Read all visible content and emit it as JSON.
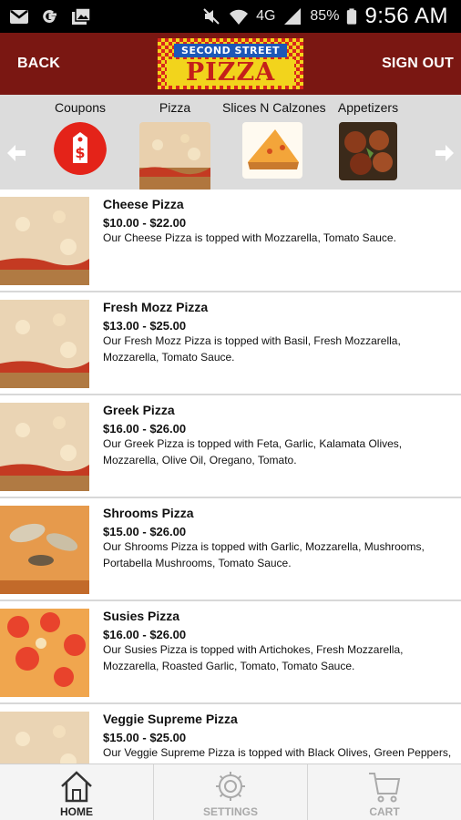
{
  "status_bar": {
    "network": "4G",
    "battery": "85%",
    "time": "9:56 AM"
  },
  "header": {
    "back_label": "BACK",
    "signout_label": "SIGN OUT",
    "logo_top": "SECOND STREET",
    "logo_main": "PIZZA",
    "brand_red": "#7a1712",
    "logo_yellow": "#f2d41c"
  },
  "categories": [
    {
      "label": "Coupons",
      "icon": "price-tag-icon"
    },
    {
      "label": "Pizza",
      "icon": "pizza-thumb"
    },
    {
      "label": "Slices N Calzones",
      "icon": "slice-thumb"
    },
    {
      "label": "Appetizers",
      "icon": "appetizer-thumb"
    }
  ],
  "menu": [
    {
      "name": "Cheese Pizza",
      "price": "$10.00 - $22.00",
      "desc": "Our Cheese Pizza is topped with Mozzarella, Tomato Sauce."
    },
    {
      "name": "Fresh Mozz Pizza",
      "price": "$13.00 - $25.00",
      "desc": "Our Fresh Mozz Pizza is topped with Basil, Fresh Mozzarella, Mozzarella, Tomato Sauce."
    },
    {
      "name": "Greek Pizza",
      "price": "$16.00 - $26.00",
      "desc": "Our Greek Pizza is topped with Feta, Garlic, Kalamata Olives, Mozzarella, Olive Oil, Oregano, Tomato."
    },
    {
      "name": "Shrooms Pizza",
      "price": "$15.00 - $26.00",
      "desc": "Our Shrooms Pizza is topped with Garlic, Mozzarella, Mushrooms, Portabella Mushrooms, Tomato Sauce."
    },
    {
      "name": "Susies Pizza",
      "price": "$16.00 - $26.00",
      "desc": "Our Susies Pizza is topped with Artichokes, Fresh Mozzarella, Mozzarella, Roasted Garlic, Tomato, Tomato Sauce."
    },
    {
      "name": "Veggie Supreme Pizza",
      "price": "$15.00 - $25.00",
      "desc": "Our Veggie Supreme Pizza is topped with Black Olives, Green Peppers,"
    }
  ],
  "bottom_nav": [
    {
      "label": "HOME",
      "icon": "home-icon",
      "active": true
    },
    {
      "label": "SETTINGS",
      "icon": "gear-icon",
      "active": false
    },
    {
      "label": "CART",
      "icon": "cart-icon",
      "active": false
    }
  ]
}
